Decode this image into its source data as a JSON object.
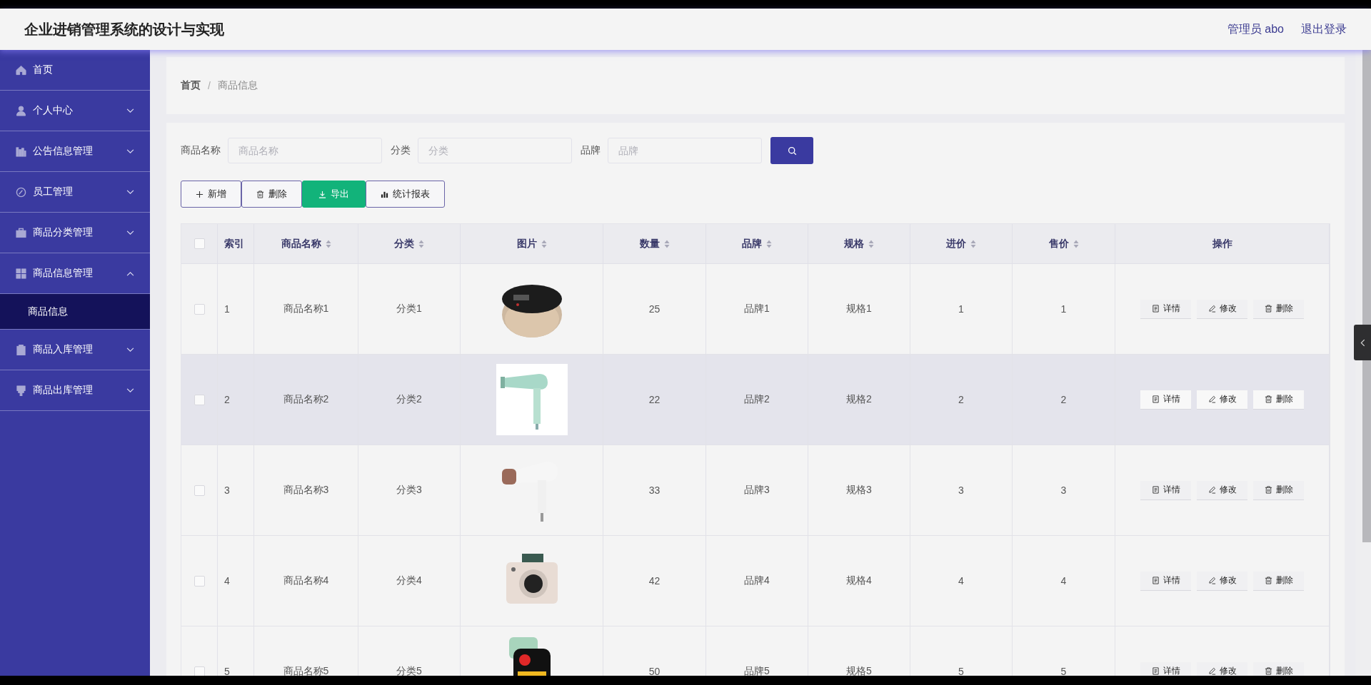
{
  "header": {
    "title": "企业进销管理系统的设计与实现",
    "user": "管理员 abo",
    "logout": "退出登录"
  },
  "sidebar": {
    "items": [
      {
        "label": "首页",
        "kind": "link"
      },
      {
        "label": "个人中心",
        "kind": "submenu",
        "expanded": false
      },
      {
        "label": "公告信息管理",
        "kind": "submenu",
        "expanded": false
      },
      {
        "label": "员工管理",
        "kind": "submenu",
        "expanded": false
      },
      {
        "label": "商品分类管理",
        "kind": "submenu",
        "expanded": false
      },
      {
        "label": "商品信息管理",
        "kind": "submenu",
        "expanded": true,
        "children": [
          {
            "label": "商品信息",
            "selected": true
          }
        ]
      },
      {
        "label": "商品入库管理",
        "kind": "submenu",
        "expanded": false
      },
      {
        "label": "商品出库管理",
        "kind": "submenu",
        "expanded": false
      }
    ]
  },
  "breadcrumb": {
    "items": [
      "首页",
      "商品信息"
    ],
    "separator": "/"
  },
  "search": {
    "fields": [
      {
        "label": "商品名称",
        "placeholder": "商品名称"
      },
      {
        "label": "分类",
        "placeholder": "分类"
      },
      {
        "label": "品牌",
        "placeholder": "品牌"
      }
    ]
  },
  "toolbar": [
    {
      "label": "新增",
      "kind": "add"
    },
    {
      "label": "删除",
      "kind": "delete"
    },
    {
      "label": "导出",
      "kind": "export"
    },
    {
      "label": "统计报表",
      "kind": "report"
    }
  ],
  "table": {
    "select_all": {
      "checked": false
    },
    "columns": [
      {
        "label": "索引",
        "sortable": false
      },
      {
        "label": "商品名称",
        "sortable": true
      },
      {
        "label": "分类",
        "sortable": true
      },
      {
        "label": "图片",
        "sortable": true
      },
      {
        "label": "数量",
        "sortable": true
      },
      {
        "label": "品牌",
        "sortable": true
      },
      {
        "label": "规格",
        "sortable": true
      },
      {
        "label": "进价",
        "sortable": true
      },
      {
        "label": "售价",
        "sortable": true
      },
      {
        "label": "操作",
        "sortable": false
      }
    ],
    "rows": [
      {
        "checked": false,
        "highlighted": false,
        "index": "1",
        "name": "商品名称1",
        "category": "分类1",
        "quantity": "25",
        "brand": "品牌1",
        "spec": "规格1",
        "cost": "1",
        "price": "1",
        "actions": [
          {
            "label": "详情",
            "kind": "detail"
          },
          {
            "label": "修改",
            "kind": "edit"
          },
          {
            "label": "删除",
            "kind": "delete"
          }
        ]
      },
      {
        "checked": false,
        "highlighted": true,
        "index": "2",
        "name": "商品名称2",
        "category": "分类2",
        "quantity": "22",
        "brand": "品牌2",
        "spec": "规格2",
        "cost": "2",
        "price": "2",
        "actions": [
          {
            "label": "详情",
            "kind": "detail"
          },
          {
            "label": "修改",
            "kind": "edit"
          },
          {
            "label": "删除",
            "kind": "delete"
          }
        ]
      },
      {
        "checked": false,
        "highlighted": false,
        "index": "3",
        "name": "商品名称3",
        "category": "分类3",
        "quantity": "33",
        "brand": "品牌3",
        "spec": "规格3",
        "cost": "3",
        "price": "3",
        "actions": [
          {
            "label": "详情",
            "kind": "detail"
          },
          {
            "label": "修改",
            "kind": "edit"
          },
          {
            "label": "删除",
            "kind": "delete"
          }
        ]
      },
      {
        "checked": false,
        "highlighted": false,
        "index": "4",
        "name": "商品名称4",
        "category": "分类4",
        "quantity": "42",
        "brand": "品牌4",
        "spec": "规格4",
        "cost": "4",
        "price": "4",
        "actions": [
          {
            "label": "详情",
            "kind": "detail"
          },
          {
            "label": "修改",
            "kind": "edit"
          },
          {
            "label": "删除",
            "kind": "delete"
          }
        ]
      },
      {
        "checked": false,
        "highlighted": false,
        "index": "5",
        "name": "商品名称5",
        "category": "分类5",
        "quantity": "50",
        "brand": "品牌5",
        "spec": "规格5",
        "cost": "5",
        "price": "5",
        "actions": [
          {
            "label": "详情",
            "kind": "detail"
          },
          {
            "label": "修改",
            "kind": "edit"
          },
          {
            "label": "删除",
            "kind": "delete"
          }
        ]
      }
    ]
  }
}
